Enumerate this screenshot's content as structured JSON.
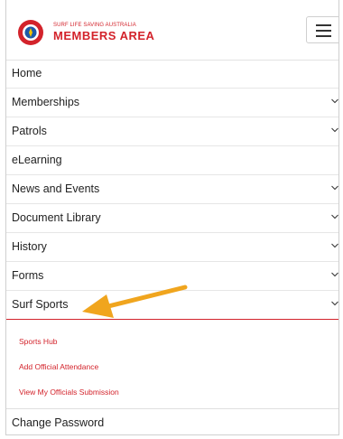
{
  "header": {
    "brand_small": "SURF LIFE SAVING AUSTRALIA",
    "brand_title": "MEMBERS AREA",
    "logo_icon": "sls-logo-icon",
    "menu_icon": "hamburger-menu-icon"
  },
  "nav": {
    "items": [
      {
        "label": "Home",
        "has_children": false
      },
      {
        "label": "Memberships",
        "has_children": true
      },
      {
        "label": "Patrols",
        "has_children": true
      },
      {
        "label": "eLearning",
        "has_children": false
      },
      {
        "label": "News and Events",
        "has_children": true
      },
      {
        "label": "Document Library",
        "has_children": true
      },
      {
        "label": "History",
        "has_children": true
      },
      {
        "label": "Forms",
        "has_children": true
      },
      {
        "label": "Surf Sports",
        "has_children": true,
        "expanded": true
      }
    ],
    "submenu": [
      {
        "label": "Sports Hub"
      },
      {
        "label": "Add Official Attendance"
      },
      {
        "label": "View My Officials Submission"
      }
    ],
    "after": {
      "label": "Change Password"
    }
  },
  "colors": {
    "brand_red": "#d3232b",
    "arrow": "#f0a51e"
  }
}
